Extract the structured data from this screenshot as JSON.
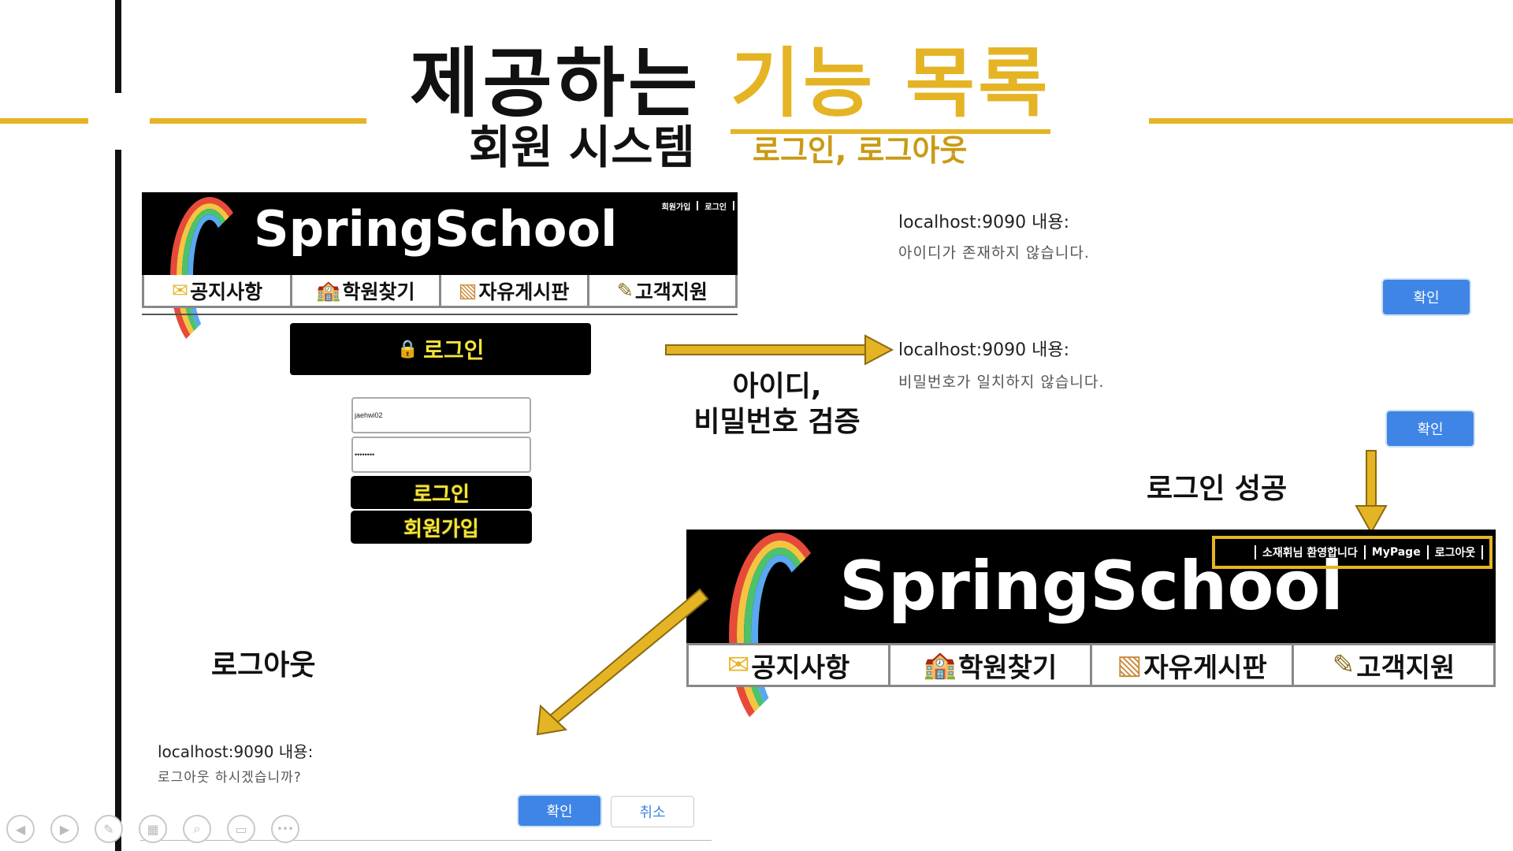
{
  "slide": {
    "title_black": "제공하는",
    "title_accent": "기능 목록",
    "subtitle": "회원 시스템",
    "subtitle_note": "로그인, 로그아웃"
  },
  "site_small": {
    "logo": "SpringSchool",
    "top_links": [
      "회원가입",
      "로그인"
    ],
    "nav": [
      "공지사항",
      "학원찾기",
      "자유게시판",
      "고객지원"
    ],
    "login_banner": "로그인",
    "id_value": "jaehwi02",
    "pw_value": "••••••••",
    "login_button": "로그인",
    "signup_button": "회원가입"
  },
  "site_large": {
    "logo": "SpringSchool",
    "top_links": [
      "소재휘님 환영합니다",
      "MyPage",
      "로그아웃"
    ],
    "nav": [
      "공지사항",
      "학원찾기",
      "자유게시판",
      "고객지원"
    ]
  },
  "dialogs": {
    "no_id": {
      "origin": "localhost:9090 내용:",
      "message": "아이디가 존재하지 않습니다.",
      "ok": "확인"
    },
    "bad_pw": {
      "origin": "localhost:9090 내용:",
      "message": "비밀번호가 일치하지 않습니다.",
      "ok": "확인"
    },
    "logout": {
      "origin": "localhost:9090 내용:",
      "message": "로그아웃 하시겠습니까?",
      "ok": "확인",
      "cancel": "취소"
    }
  },
  "labels": {
    "verify_line1": "아이디,",
    "verify_line2": "비밀번호 검증",
    "login_success": "로그인 성공",
    "logout": "로그아웃"
  },
  "colors": {
    "accent": "#e5b425",
    "dialog_blue": "#3f85e6",
    "header_bg": "#000000"
  },
  "player_controls": [
    "prev-icon",
    "next-icon",
    "pen-icon",
    "slides-icon",
    "zoom-icon",
    "subtitles-icon",
    "more-icon"
  ]
}
